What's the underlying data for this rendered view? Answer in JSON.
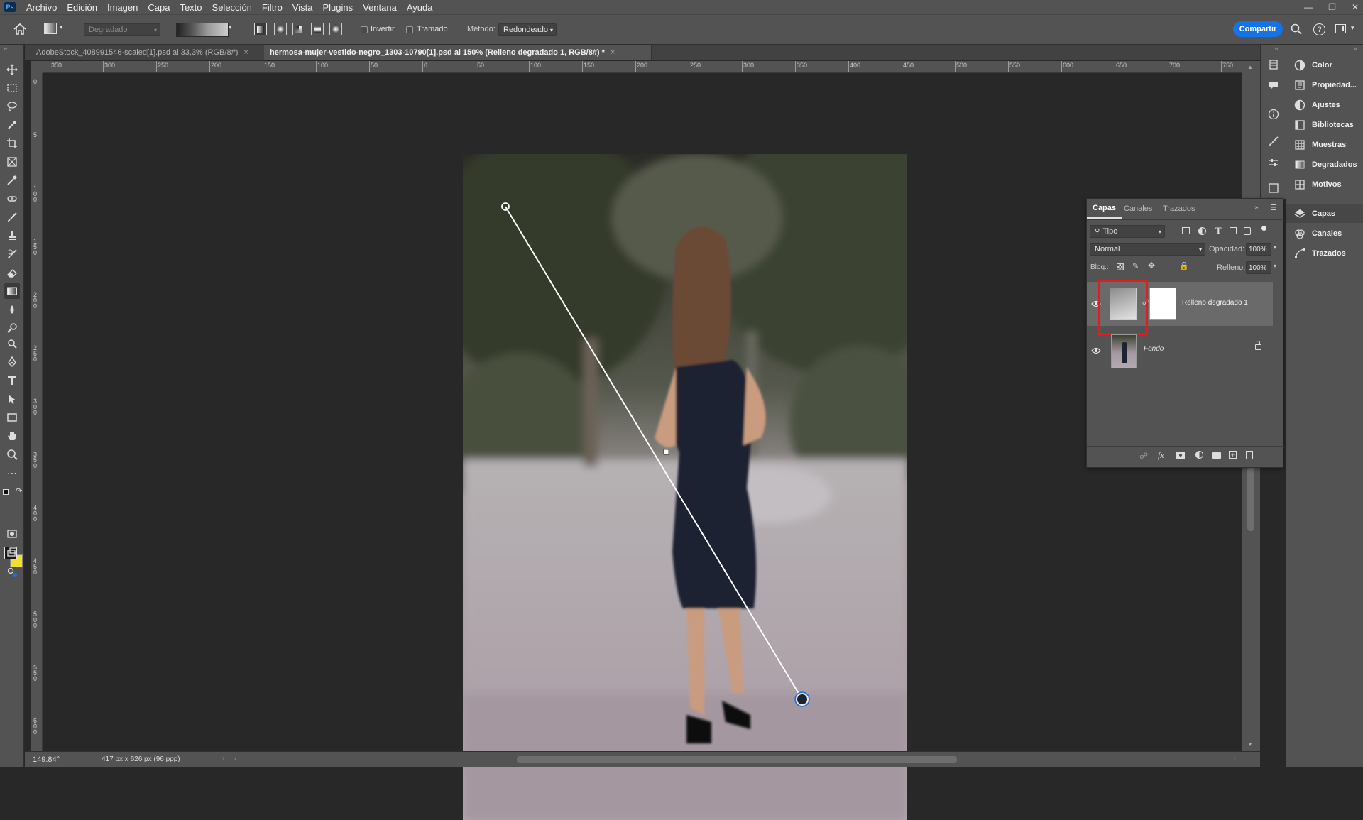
{
  "app": {
    "logo": "Ps"
  },
  "menubar": {
    "items": [
      "Archivo",
      "Edición",
      "Imagen",
      "Capa",
      "Texto",
      "Selección",
      "Filtro",
      "Vista",
      "Plugins",
      "Ventana",
      "Ayuda"
    ],
    "window_controls": [
      "minimize-icon",
      "restore-icon",
      "close-icon"
    ]
  },
  "options": {
    "preset_placeholder": "Degradado",
    "invert_label": "Invertir",
    "dither_label": "Tramado",
    "method_label": "Método:",
    "method_value": "Redondeado",
    "share_label": "Compartir"
  },
  "tabs": [
    {
      "title": "AdobeStock_408991546-scaled[1].psd al 33,3% (RGB/8#)",
      "close": "×"
    },
    {
      "title": "hermosa-mujer-vestido-negro_1303-10790[1].psd al 150% (Relleno degradado 1, RGB/8#) *",
      "close": "×"
    }
  ],
  "ruler_h": [
    "350",
    "300",
    "250",
    "200",
    "150",
    "100",
    "50",
    "0",
    "50",
    "100",
    "150",
    "200",
    "250",
    "300",
    "350",
    "400",
    "450",
    "500",
    "550",
    "600",
    "650",
    "700",
    "750"
  ],
  "ruler_v": [
    "0",
    "5",
    "1 0 0",
    "1 5 0",
    "2 0 0",
    "2 5 0",
    "3 0 0",
    "3 5 0",
    "4 0 0",
    "4 5 0",
    "5 0 0",
    "5 5 0",
    "6 0 0"
  ],
  "status": {
    "zoom": "149.84°",
    "doc_info": "417 px x 626 px (96 ppp)"
  },
  "dock": {
    "items": [
      {
        "label": "Color",
        "icon": "color-icon"
      },
      {
        "label": "Propiedad...",
        "icon": "properties-icon"
      },
      {
        "label": "Ajustes",
        "icon": "adjustments-icon"
      },
      {
        "label": "Bibliotecas",
        "icon": "libraries-icon"
      },
      {
        "label": "Muestras",
        "icon": "swatches-icon"
      },
      {
        "label": "Degradados",
        "icon": "gradients-icon"
      },
      {
        "label": "Motivos",
        "icon": "patterns-icon"
      },
      {
        "label": "Capas",
        "icon": "layers-icon"
      },
      {
        "label": "Canales",
        "icon": "channels-icon"
      },
      {
        "label": "Trazados",
        "icon": "paths-icon"
      }
    ]
  },
  "layers_panel": {
    "tabs": [
      "Capas",
      "Canales",
      "Trazados"
    ],
    "filter_value": "Tipo",
    "blend_mode": "Normal",
    "opacity_label": "Opacidad:",
    "opacity_value": "100%",
    "lock_label": "Bloq.:",
    "fill_label": "Relleno:",
    "fill_value": "100%",
    "layers": [
      {
        "name": "Relleno degradado 1",
        "selected": true,
        "highlighted_thumb": true
      },
      {
        "name": "Fondo",
        "selected": false,
        "locked": true
      }
    ]
  },
  "colors": {
    "accent": "#1473e6",
    "highlight": "#e01e1e",
    "foreground_swatch": "#1a1a1a",
    "background_swatch": "#f2e12c"
  }
}
